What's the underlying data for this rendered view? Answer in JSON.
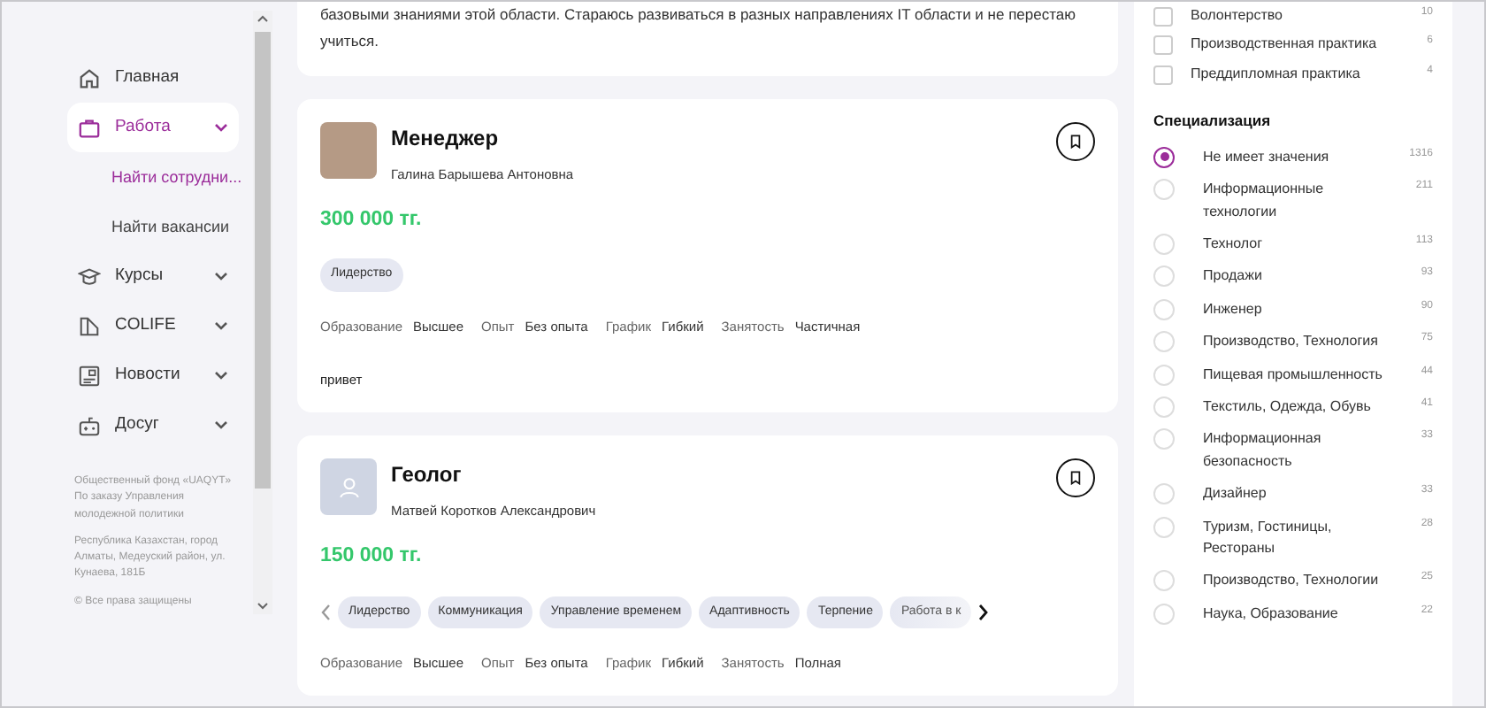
{
  "sidebar": {
    "items": [
      {
        "label": "Главная",
        "selected": false
      },
      {
        "label": "Работа",
        "selected": true,
        "expanded": true,
        "children": [
          {
            "label": "Найти сотрудни...",
            "selected": true
          },
          {
            "label": "Найти вакансии",
            "selected": false
          }
        ]
      },
      {
        "label": "Курсы",
        "selected": false,
        "expanded": false
      },
      {
        "label": "COLIFE",
        "selected": false,
        "expanded": false
      },
      {
        "label": "Новости",
        "selected": false,
        "expanded": false
      },
      {
        "label": "Досуг",
        "selected": false,
        "expanded": false
      }
    ],
    "footer": [
      "Общественный фонд «UAQYT» По заказу Управления молодежной политики",
      "Республика Казахстан, город Алматы, Медеуский район, ул. Кунаева, 181Б",
      "© Все права защищены"
    ]
  },
  "intro_card": {
    "text": "базовыми знаниями этой области. Стараюсь развиваться в разных направлениях IT области и не перестаю учиться."
  },
  "vacancies": [
    {
      "title": "Менеджер",
      "person": "Галина Барышева Антоновна",
      "avatar": {
        "kind": "photo"
      },
      "salary": "300 000 тг.",
      "skills_scrollable": false,
      "skills": [
        "Лидерство"
      ],
      "details": [
        {
          "label": "Образование",
          "value": "Высшее"
        },
        {
          "label": "Опыт",
          "value": "Без опыта"
        },
        {
          "label": "График",
          "value": "Гибкий"
        },
        {
          "label": "Занятость",
          "value": "Частичная"
        }
      ],
      "description": "привет"
    },
    {
      "title": "Геолог",
      "person": "Матвей Коротков Александрович",
      "avatar": {
        "kind": "generic"
      },
      "salary": "150 000 тг.",
      "skills_scrollable": true,
      "skills": [
        "Лидерство",
        "Коммуникация",
        "Управление временем",
        "Адаптивность",
        "Терпение",
        "Работа в к"
      ],
      "details": [
        {
          "label": "Образование",
          "value": "Высшее"
        },
        {
          "label": "Опыт",
          "value": "Без опыта"
        },
        {
          "label": "График",
          "value": "Гибкий"
        },
        {
          "label": "Занятость",
          "value": "Полная"
        }
      ]
    }
  ],
  "filters": {
    "checkboxes": [
      {
        "label": "Волонтерство",
        "count": "10",
        "checked": false
      },
      {
        "label": "Производственная практика",
        "count": "6",
        "checked": false
      },
      {
        "label": "Преддипломная практика",
        "count": "4",
        "checked": false
      }
    ],
    "specialization": {
      "title": "Специализация",
      "options": [
        {
          "label": "Не имеет значения",
          "count": "1316",
          "selected": true
        },
        {
          "label": "Информационные технологии",
          "count": "211",
          "selected": false
        },
        {
          "label": "Технолог",
          "count": "113",
          "selected": false
        },
        {
          "label": "Продажи",
          "count": "93",
          "selected": false
        },
        {
          "label": "Инженер",
          "count": "90",
          "selected": false
        },
        {
          "label": "Производство, Технология",
          "count": "75",
          "selected": false
        },
        {
          "label": "Пищевая промышленность",
          "count": "44",
          "selected": false
        },
        {
          "label": "Текстиль, Одежда, Обувь",
          "count": "41",
          "selected": false
        },
        {
          "label": "Информационная безопасность",
          "count": "33",
          "selected": false
        },
        {
          "label": "Дизайнер",
          "count": "33",
          "selected": false
        },
        {
          "label": "Туризм, Гостиницы, Рестораны",
          "count": "28",
          "selected": false
        },
        {
          "label": "Производство, Технологии",
          "count": "25",
          "selected": false
        },
        {
          "label": "Наука, Образование",
          "count": "22",
          "selected": false
        }
      ]
    }
  }
}
